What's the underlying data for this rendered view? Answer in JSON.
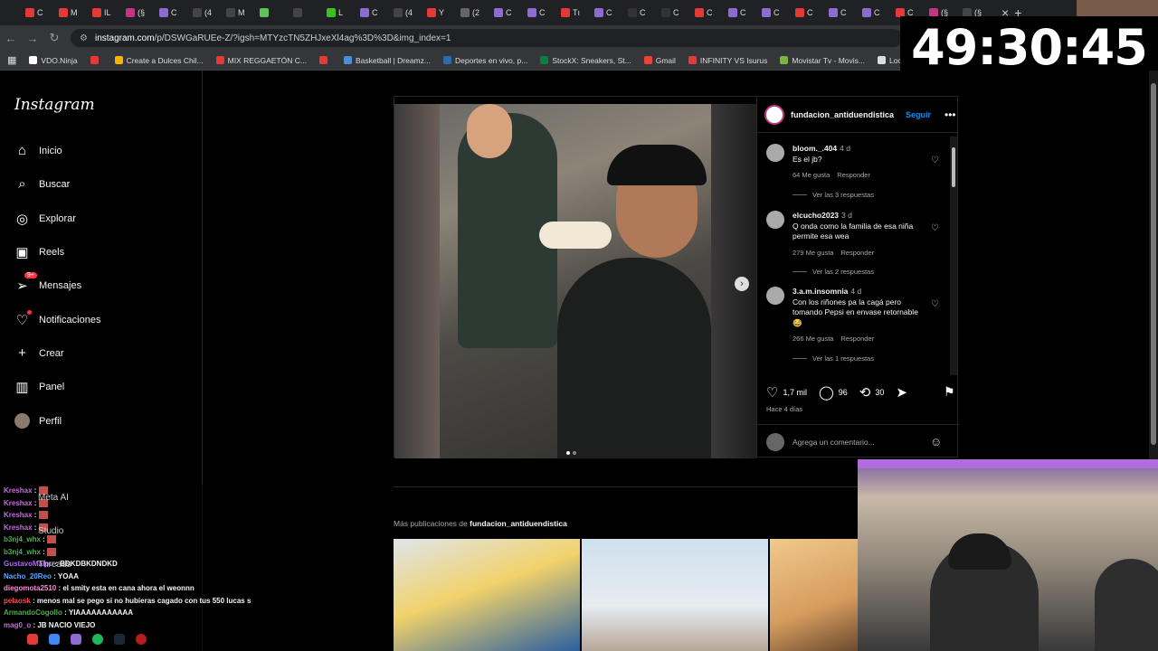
{
  "browser": {
    "tabs": [
      "C",
      "M",
      "IL",
      "(§",
      "C",
      "(4",
      "M",
      "",
      "",
      "L",
      "C",
      "(4",
      "Y",
      "(2",
      "C",
      "C",
      "Tı",
      "C",
      "C",
      "C",
      "C",
      "C",
      "C",
      "C",
      "C",
      "C",
      "C",
      "(§",
      "(§"
    ],
    "tab_colors": [
      "#e53935",
      "#e53935",
      "#e53935",
      "#c13584",
      "#8e6bd1",
      "#444",
      "#444",
      "#5ac35a",
      "#444",
      "#3ec11f",
      "#8e6bd1",
      "#444",
      "#e53935",
      "#666",
      "#8e6bd1",
      "#8e6bd1",
      "#e53935",
      "#8e6bd1",
      "#333",
      "#333",
      "#e53935",
      "#8e6bd1",
      "#8e6bd1",
      "#e53935",
      "#8e6bd1",
      "#8e6bd1",
      "#e53935",
      "#c13584",
      "#444"
    ],
    "close_glyph": "×",
    "new_tab_glyph": "+",
    "url_host": "instagram.com",
    "url_path": "/p/DSWGaRUEe-Z/?igsh=MTYzcTN5ZHJxeXl4ag%3D%3D&img_index=1",
    "bookmarks": [
      {
        "label": "VDO.Ninja",
        "color": "#ffffff"
      },
      {
        "label": "",
        "color": "#e53935"
      },
      {
        "label": "Create a Dulces Chil...",
        "color": "#f4b400"
      },
      {
        "label": "MIX REGGAETÓN C...",
        "color": "#e53935"
      },
      {
        "label": "",
        "color": "#e53935"
      },
      {
        "label": "Basketball | Dreamz...",
        "color": "#4a90d9"
      },
      {
        "label": "Deportes en vivo, p...",
        "color": "#2b6cb0"
      },
      {
        "label": "StockX: Sneakers, St...",
        "color": "#0a7f3f"
      },
      {
        "label": "Gmail",
        "color": "#ea4335"
      },
      {
        "label": "INFINITY VS Isurus",
        "color": "#e53935"
      },
      {
        "label": "Movistar Tv - Movis...",
        "color": "#7cb342"
      },
      {
        "label": "Lootie.com: Open...",
        "color": "#ddd"
      }
    ]
  },
  "overlay": {
    "timer": "49:30:45"
  },
  "sidebar": {
    "logo": "Instagram",
    "items": [
      {
        "label": "Inicio",
        "icon": "home-icon",
        "glyph": "⌂"
      },
      {
        "label": "Buscar",
        "icon": "search-icon",
        "glyph": "⌕"
      },
      {
        "label": "Explorar",
        "icon": "explore-icon",
        "glyph": "◎"
      },
      {
        "label": "Reels",
        "icon": "reels-icon",
        "glyph": "▣"
      },
      {
        "label": "Mensajes",
        "icon": "messages-icon",
        "glyph": "➢",
        "badge": "9+"
      },
      {
        "label": "Notificaciones",
        "icon": "heart-icon",
        "glyph": "♡"
      },
      {
        "label": "Crear",
        "icon": "plus-icon",
        "glyph": "+"
      },
      {
        "label": "Panel",
        "icon": "panel-icon",
        "glyph": "▥"
      },
      {
        "label": "Perfil",
        "icon": "avatar",
        "glyph": ""
      }
    ],
    "more": [
      {
        "label": "Meta AI"
      },
      {
        "label": "Studio"
      },
      {
        "label": "Threads"
      }
    ]
  },
  "post": {
    "username": "fundacion_antiduendistica",
    "follow_label": "Seguir",
    "more_glyph": "•••",
    "next_glyph": "›",
    "likes": "1,7 mil",
    "comments_count": "96",
    "reposts": "30",
    "posted": "Hace 4 días",
    "add_comment_placeholder": "Agrega un comentario...",
    "comments": [
      {
        "user": "bloom._.404",
        "time": "4 d",
        "text": "Es el jb?",
        "likes": "64 Me gusta",
        "reply": "Responder",
        "replies": "Ver las 3 respuestas"
      },
      {
        "user": "elcucho2023",
        "time": "3 d",
        "text": "Q onda como la familia de esa niña permite esa wea",
        "likes": "279 Me gusta",
        "reply": "Responder",
        "replies": "Ver las 2 respuestas"
      },
      {
        "user": "3.a.m.insomnia",
        "time": "4 d",
        "text": "Con los riñones pa la cagá pero tomando Pepsi en envase retornable 😂",
        "likes": "266 Me gusta",
        "reply": "Responder",
        "replies": "Ver las 1 respuestas"
      }
    ]
  },
  "more_posts": {
    "prefix": "Más publicaciones de",
    "user": "fundacion_antiduendistica"
  },
  "chat": [
    {
      "user": "Kreshax",
      "color": "#c46bd9",
      "msg": ""
    },
    {
      "user": "Kreshax",
      "color": "#c46bd9",
      "msg": ""
    },
    {
      "user": "Kreshax",
      "color": "#c46bd9",
      "msg": ""
    },
    {
      "user": "Kreshax",
      "color": "#c46bd9",
      "msg": ""
    },
    {
      "user": "b3nj4_whx",
      "color": "#4caf50",
      "msg": ""
    },
    {
      "user": "b3nj4_whx",
      "color": "#4caf50",
      "msg": ""
    },
    {
      "user": "GustavoMaipu",
      "color": "#b266ff",
      "msg": "BDKDBKDNDKD"
    },
    {
      "user": "Nacho_20Reo",
      "color": "#5da9ff",
      "msg": "YOAA"
    },
    {
      "user": "diegomota2510",
      "color": "#ff8ad8",
      "msg": "el smity esta en cana ahora el weonnn"
    },
    {
      "user": "pelaosk",
      "color": "#ff4d4d",
      "msg": "menos mal se pego si no hubieras cagado con tus 550 lucas s"
    },
    {
      "user": "ArmandoCogollo",
      "color": "#4caf50",
      "msg": "YIAAAAAAAAAAA"
    },
    {
      "user": "mag0_o",
      "color": "#c46bd9",
      "msg": "JB NACIO VIEJO"
    }
  ]
}
